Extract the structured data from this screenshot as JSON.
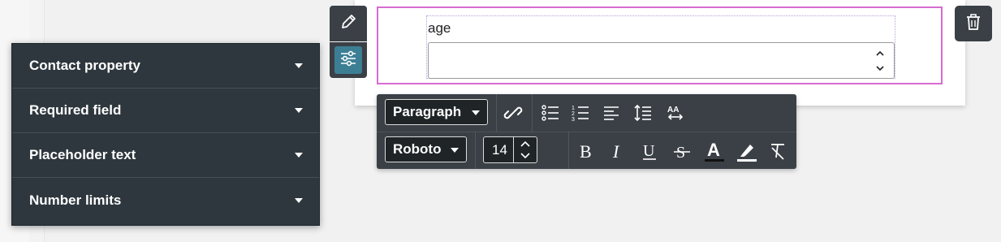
{
  "form_field": {
    "label": "age",
    "value": ""
  },
  "properties_panel": {
    "items": [
      {
        "label": "Contact property"
      },
      {
        "label": "Required field"
      },
      {
        "label": "Placeholder text"
      },
      {
        "label": "Number limits"
      }
    ]
  },
  "toolbar": {
    "block_format": "Paragraph",
    "font_family": "Roboto",
    "font_size": "14"
  },
  "icons": {
    "edit": "pencil-icon",
    "settings": "sliders-icon",
    "delete": "trash-icon",
    "unlink": "unlink-icon",
    "bullet_list": "bullet-list-icon",
    "numbered_list": "numbered-list-icon",
    "align": "align-left-icon",
    "line_height": "line-height-icon",
    "char_spacing": "character-spacing-icon",
    "bold": "bold-icon",
    "italic": "italic-icon",
    "underline": "underline-icon",
    "strikethrough": "strikethrough-icon",
    "text_color": "text-color-icon",
    "highlight": "highlight-icon",
    "clear_format": "clear-formatting-icon"
  },
  "colors": {
    "selection_border": "#d76bd0",
    "active_setting": "#3c7f94",
    "panel_bg": "#2e373d",
    "toolbar_bg": "#3a4046"
  }
}
